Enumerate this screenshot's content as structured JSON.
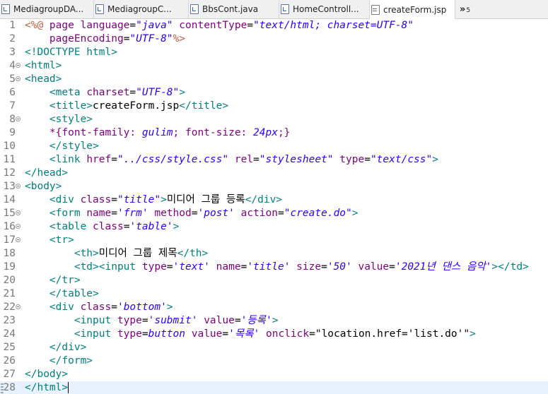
{
  "tabs": [
    {
      "label": "MediagroupDA...",
      "icon": "java-class-icon",
      "active": false
    },
    {
      "label": "MediagroupC...",
      "icon": "java-file-icon",
      "active": false
    },
    {
      "label": "BbsCont.java",
      "icon": "java-file-icon",
      "active": false
    },
    {
      "label": "HomeControll...",
      "icon": "java-file-icon",
      "active": false
    },
    {
      "label": "createForm.jsp",
      "icon": "jsp-file-icon",
      "active": true
    }
  ],
  "overflow": {
    "chevron": "»",
    "count": "5"
  },
  "editor": {
    "current_line": 28,
    "lines": [
      {
        "n": "1",
        "fold": false,
        "spans": [
          [
            "jsp",
            "<%@ "
          ],
          [
            "attr",
            "page "
          ],
          [
            "attr",
            "language"
          ],
          [
            "text",
            "="
          ],
          [
            "val",
            "\"java\""
          ],
          [
            "text",
            " "
          ],
          [
            "attr",
            "contentType"
          ],
          [
            "text",
            "="
          ],
          [
            "val",
            "\"text/html; charset=UTF-8\""
          ]
        ]
      },
      {
        "n": "2",
        "fold": false,
        "spans": [
          [
            "text",
            "    "
          ],
          [
            "attr",
            "pageEncoding"
          ],
          [
            "text",
            "="
          ],
          [
            "val",
            "\"UTF-8\""
          ],
          [
            "jsp",
            "%>"
          ]
        ]
      },
      {
        "n": "3",
        "fold": false,
        "spans": [
          [
            "doc",
            "<!DOCTYPE html>"
          ]
        ]
      },
      {
        "n": "4",
        "fold": true,
        "spans": [
          [
            "tag",
            "<html>"
          ]
        ]
      },
      {
        "n": "5",
        "fold": true,
        "spans": [
          [
            "tag",
            "<head>"
          ]
        ]
      },
      {
        "n": "6",
        "fold": false,
        "spans": [
          [
            "text",
            "    "
          ],
          [
            "tag",
            "<meta "
          ],
          [
            "attr",
            "charset"
          ],
          [
            "text",
            "="
          ],
          [
            "val",
            "\"UTF-8\""
          ],
          [
            "tag",
            ">"
          ]
        ]
      },
      {
        "n": "7",
        "fold": false,
        "spans": [
          [
            "text",
            "    "
          ],
          [
            "tag",
            "<title>"
          ],
          [
            "text",
            "createForm.jsp"
          ],
          [
            "tag",
            "</title>"
          ]
        ]
      },
      {
        "n": "8",
        "fold": true,
        "spans": [
          [
            "text",
            "    "
          ],
          [
            "tag",
            "<style>"
          ]
        ]
      },
      {
        "n": "9",
        "fold": false,
        "spans": [
          [
            "text",
            "    "
          ],
          [
            "css",
            "*{font-family: "
          ],
          [
            "cssv",
            "gulim"
          ],
          [
            "css",
            "; font-size: "
          ],
          [
            "cssv",
            "24px"
          ],
          [
            "css",
            ";}"
          ]
        ]
      },
      {
        "n": "10",
        "fold": false,
        "spans": [
          [
            "text",
            "    "
          ],
          [
            "tag",
            "</style>"
          ]
        ]
      },
      {
        "n": "11",
        "fold": false,
        "spans": [
          [
            "text",
            "    "
          ],
          [
            "tag",
            "<link "
          ],
          [
            "attr",
            "href"
          ],
          [
            "text",
            "="
          ],
          [
            "val",
            "\"../css/style.css\""
          ],
          [
            "text",
            " "
          ],
          [
            "attr",
            "rel"
          ],
          [
            "text",
            "="
          ],
          [
            "val",
            "\"stylesheet\""
          ],
          [
            "text",
            " "
          ],
          [
            "attr",
            "type"
          ],
          [
            "text",
            "="
          ],
          [
            "val",
            "\"text/css\""
          ],
          [
            "tag",
            ">"
          ]
        ]
      },
      {
        "n": "12",
        "fold": false,
        "spans": [
          [
            "tag",
            "</head>"
          ]
        ]
      },
      {
        "n": "13",
        "fold": true,
        "spans": [
          [
            "tag",
            "<body>"
          ]
        ]
      },
      {
        "n": "14",
        "fold": false,
        "spans": [
          [
            "text",
            "    "
          ],
          [
            "tag",
            "<div "
          ],
          [
            "attr",
            "class"
          ],
          [
            "text",
            "="
          ],
          [
            "val",
            "\"title\""
          ],
          [
            "tag",
            ">"
          ],
          [
            "text",
            "미디어 그룹 등록"
          ],
          [
            "tag",
            "</div>"
          ]
        ]
      },
      {
        "n": "15",
        "fold": true,
        "spans": [
          [
            "text",
            "    "
          ],
          [
            "tag",
            "<form "
          ],
          [
            "attr",
            "name"
          ],
          [
            "text",
            "="
          ],
          [
            "val",
            "'frm'"
          ],
          [
            "text",
            " "
          ],
          [
            "attr",
            "method"
          ],
          [
            "text",
            "="
          ],
          [
            "val",
            "'post'"
          ],
          [
            "text",
            " "
          ],
          [
            "attr",
            "action"
          ],
          [
            "text",
            "="
          ],
          [
            "val",
            "\"create.do\""
          ],
          [
            "tag",
            ">"
          ]
        ]
      },
      {
        "n": "16",
        "fold": true,
        "spans": [
          [
            "text",
            "    "
          ],
          [
            "tag",
            "<table "
          ],
          [
            "attr",
            "class"
          ],
          [
            "text",
            "="
          ],
          [
            "val",
            "'table'"
          ],
          [
            "tag",
            ">"
          ]
        ]
      },
      {
        "n": "17",
        "fold": true,
        "spans": [
          [
            "text",
            "    "
          ],
          [
            "tag",
            "<tr>"
          ]
        ]
      },
      {
        "n": "18",
        "fold": false,
        "spans": [
          [
            "text",
            "        "
          ],
          [
            "tag",
            "<th>"
          ],
          [
            "text",
            "미디어 그룹 제목"
          ],
          [
            "tag",
            "</th>"
          ]
        ]
      },
      {
        "n": "19",
        "fold": false,
        "spans": [
          [
            "text",
            "        "
          ],
          [
            "tag",
            "<td><input "
          ],
          [
            "attr",
            "type"
          ],
          [
            "text",
            "="
          ],
          [
            "val",
            "'text'"
          ],
          [
            "text",
            " "
          ],
          [
            "attr",
            "name"
          ],
          [
            "text",
            "="
          ],
          [
            "val",
            "'title'"
          ],
          [
            "text",
            " "
          ],
          [
            "attr",
            "size"
          ],
          [
            "text",
            "="
          ],
          [
            "val",
            "'50'"
          ],
          [
            "text",
            " "
          ],
          [
            "attr",
            "value"
          ],
          [
            "text",
            "="
          ],
          [
            "val",
            "'2021년 댄스 음악'"
          ],
          [
            "tag",
            "></td>"
          ]
        ]
      },
      {
        "n": "20",
        "fold": false,
        "spans": [
          [
            "text",
            "    "
          ],
          [
            "tag",
            "</tr>"
          ]
        ]
      },
      {
        "n": "21",
        "fold": false,
        "spans": [
          [
            "text",
            "    "
          ],
          [
            "tag",
            "</table>"
          ]
        ]
      },
      {
        "n": "22",
        "fold": true,
        "spans": [
          [
            "text",
            "    "
          ],
          [
            "tag",
            "<div "
          ],
          [
            "attr",
            "class"
          ],
          [
            "text",
            "="
          ],
          [
            "val",
            "'bottom'"
          ],
          [
            "tag",
            ">"
          ]
        ]
      },
      {
        "n": "23",
        "fold": false,
        "spans": [
          [
            "text",
            "        "
          ],
          [
            "tag",
            "<input "
          ],
          [
            "attr",
            "type"
          ],
          [
            "text",
            "="
          ],
          [
            "val",
            "'submit'"
          ],
          [
            "text",
            " "
          ],
          [
            "attr",
            "value"
          ],
          [
            "text",
            "="
          ],
          [
            "val",
            "'등록'"
          ],
          [
            "tag",
            ">"
          ]
        ]
      },
      {
        "n": "24",
        "fold": false,
        "spans": [
          [
            "text",
            "        "
          ],
          [
            "tag",
            "<input "
          ],
          [
            "attr",
            "type"
          ],
          [
            "text",
            "="
          ],
          [
            "val",
            "button"
          ],
          [
            "text",
            " "
          ],
          [
            "attr",
            "value"
          ],
          [
            "text",
            "="
          ],
          [
            "val",
            "'목록'"
          ],
          [
            "text",
            " "
          ],
          [
            "attr",
            "onclick"
          ],
          [
            "text",
            "="
          ],
          [
            "text",
            "\"location.href='list.do'\""
          ],
          [
            "tag",
            ">"
          ]
        ]
      },
      {
        "n": "25",
        "fold": false,
        "spans": [
          [
            "text",
            "    "
          ],
          [
            "tag",
            "</div>"
          ]
        ]
      },
      {
        "n": "26",
        "fold": false,
        "spans": [
          [
            "text",
            "    "
          ],
          [
            "tag",
            "</form>"
          ]
        ]
      },
      {
        "n": "27",
        "fold": false,
        "spans": [
          [
            "tag",
            "</body>"
          ]
        ]
      },
      {
        "n": "28",
        "fold": false,
        "spans": [
          [
            "tag",
            "</html>"
          ]
        ]
      }
    ]
  },
  "colors": {
    "tag": "#008080",
    "attr": "#7f007f",
    "value": "#2a00ff",
    "jsp": "#bf5f3f",
    "current_line_bg": "#e8f2fe"
  }
}
